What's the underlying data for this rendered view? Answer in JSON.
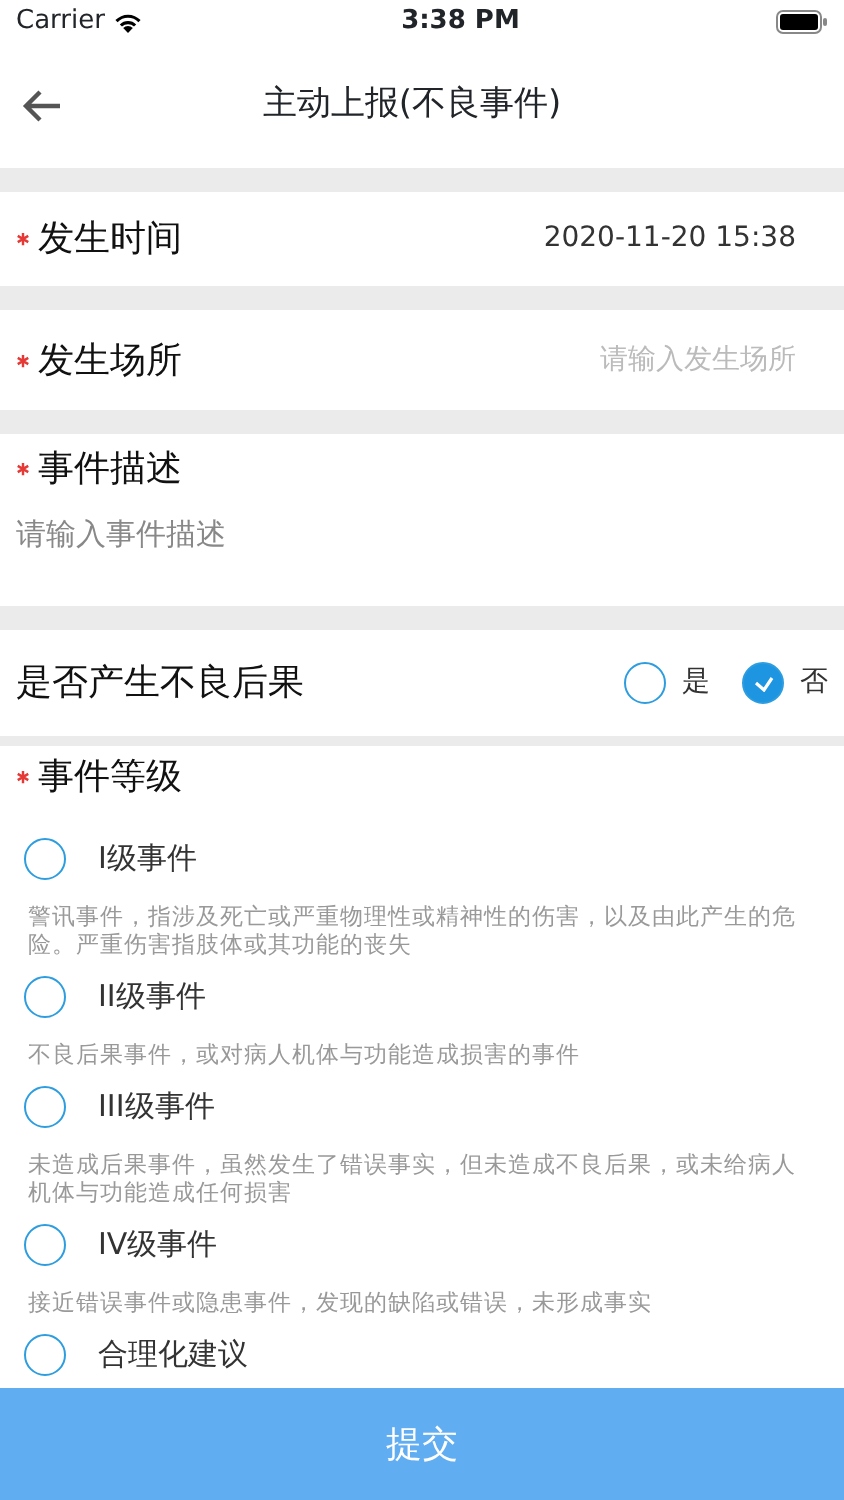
{
  "status_bar": {
    "carrier": "Carrier",
    "time": "3:38 PM"
  },
  "nav": {
    "title": "主动上报(不良事件)"
  },
  "fields": [
    {
      "kind": "value",
      "label": "发生时间",
      "required": true,
      "value": "2020-11-20 15:38"
    },
    {
      "kind": "input",
      "label": "发生场所",
      "required": true,
      "placeholder": "请输入发生场所"
    },
    {
      "kind": "textarea",
      "label": "事件描述",
      "required": true,
      "placeholder": "请输入事件描述"
    },
    {
      "kind": "choice",
      "label": "是否产生不良后果",
      "required": false,
      "options": [
        {
          "label": "是",
          "selected": false
        },
        {
          "label": "否",
          "selected": true
        }
      ]
    }
  ],
  "level": {
    "label": "事件等级",
    "required": true,
    "options": [
      {
        "label": "I级事件",
        "selected": false,
        "description": "警讯事件，指涉及死亡或严重物理性或精神性的伤害，以及由此产生的危险。严重伤害指肢体或其功能的丧失"
      },
      {
        "label": "II级事件",
        "selected": false,
        "description": "不良后果事件，或对病人机体与功能造成损害的事件"
      },
      {
        "label": "III级事件",
        "selected": false,
        "description": "未造成后果事件，虽然发生了错误事实，但未造成不良后果，或未给病人机体与功能造成任何损害"
      },
      {
        "label": "IV级事件",
        "selected": false,
        "description": "接近错误事件或隐患事件，发现的缺陷或错误，未形成事实"
      },
      {
        "label": "合理化建议",
        "selected": false
      }
    ]
  },
  "submit": "提交"
}
